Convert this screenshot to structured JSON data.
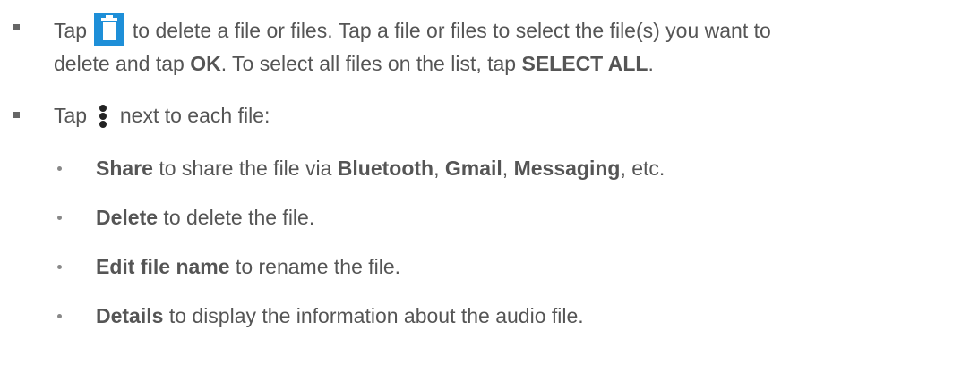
{
  "items": [
    {
      "pre_icon": "Tap",
      "icon": "trash-icon",
      "line1_rest": "to delete a file or files. Tap a file or files to select the file(s) you want to",
      "line2_a": "delete and tap ",
      "line2_b": "OK",
      "line2_c": ". To select all files on the list, tap ",
      "line2_d": "SELECT ALL",
      "line2_e": "."
    },
    {
      "pre_icon": "Tap",
      "icon": "more-vert-icon",
      "rest": "next to each file:"
    }
  ],
  "subitems": [
    {
      "term": "Share",
      "a": " to share the file via ",
      "b1": "Bluetooth",
      "s1": ", ",
      "b2": "Gmail",
      "s2": ", ",
      "b3": "Messaging",
      "c": ", etc."
    },
    {
      "term": "Delete",
      "a": " to delete the file."
    },
    {
      "term": "Edit file name",
      "a": " to rename the file."
    },
    {
      "term": "Details",
      "a": " to display the information about the audio file."
    }
  ],
  "colors": {
    "text": "#555555",
    "icon_blue": "#1e8fd8"
  }
}
